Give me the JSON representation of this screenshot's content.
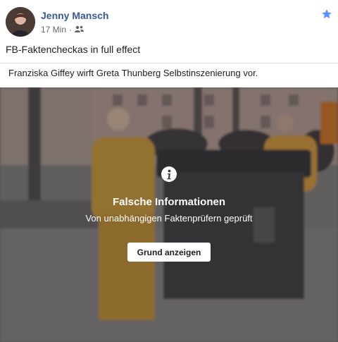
{
  "post": {
    "author": "Jenny Mansch",
    "time": "17 Min",
    "separator": "·",
    "audience_icon": "friends-icon",
    "text": "FB-Faktencheckas in full effect"
  },
  "link": {
    "title": "Franziska Giffey wirft Greta Thunberg Selbstinszenierung vor."
  },
  "warning": {
    "icon": "info-icon",
    "title": "Falsche Informationen",
    "subtitle": "Von unabhängigen Faktenprüfern geprüft",
    "button": "Grund anzeigen"
  },
  "colors": {
    "author_link": "#385898",
    "meta_gray": "#616770",
    "star": "#5890ff"
  }
}
